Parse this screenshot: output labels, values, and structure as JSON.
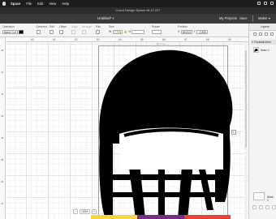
{
  "menubar": {
    "app_name": "Space",
    "items": [
      "File",
      "Edit",
      "View",
      "Help"
    ]
  },
  "window": {
    "title": "Cricut Design Space v8.12.227"
  },
  "header": {
    "doc_title": "Untitled*",
    "my_projects": "My Projects",
    "save": "Save",
    "machine": "Maker"
  },
  "toolbar": {
    "operation": {
      "label": "Operation",
      "value": "Basic Cut"
    },
    "deselect": "Deselect",
    "edit": "Edit",
    "offset": "Offset",
    "align": "Align",
    "arrange": "Arrange",
    "flip": "Flip",
    "size": {
      "label": "Size",
      "w_prefix": "W",
      "w_value": "7.774",
      "h_prefix": "H"
    },
    "rotate": "Rotate",
    "position": {
      "label": "Position",
      "x_prefix": "X",
      "x_value": "88.813",
      "y_prefix": "Y",
      "y_value": "-2.898"
    }
  },
  "ruler": {
    "h_ticks": [
      "60",
      "61",
      "62",
      "63",
      "64",
      "65",
      "66",
      "67",
      "68",
      "69",
      "70"
    ],
    "v_ticks": [
      "40",
      "41",
      "42",
      "43",
      "44",
      "45",
      "46",
      "47"
    ]
  },
  "canvas": {
    "size_label": "6.774 in",
    "rotate_glyph": "↻",
    "zoom": {
      "minus": "−",
      "value": "100%",
      "plus": "+"
    }
  },
  "layers": {
    "title": "Layers",
    "group_name": "Football-helm",
    "layer_name": "Basic C",
    "blank_canvas": "Blank C"
  },
  "colors": {
    "menubar": "#1d1d1f",
    "appbar": "#3a3a3c",
    "shape_fill": "#000000",
    "cut_strip": [
      "#ffd23f",
      "#7a2a8c",
      "#e8462c"
    ]
  }
}
